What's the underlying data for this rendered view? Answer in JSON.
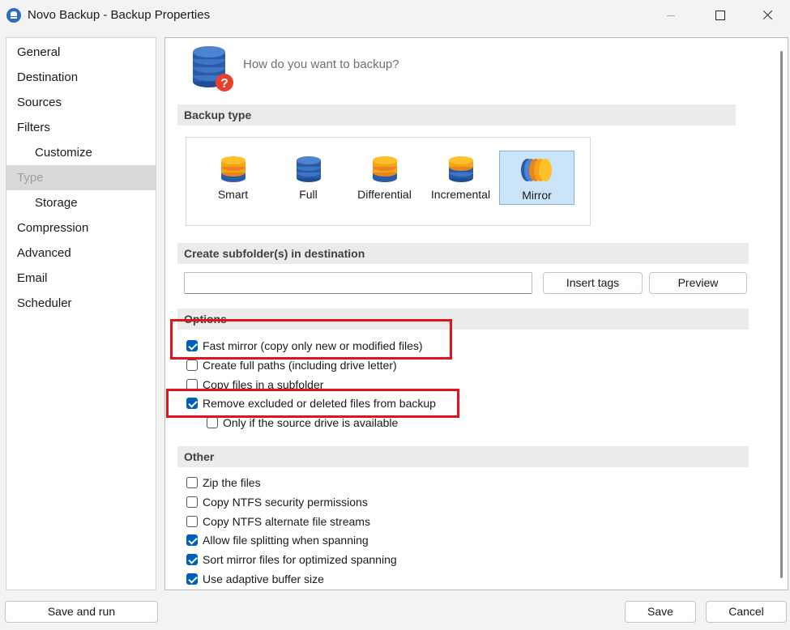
{
  "window": {
    "title": "Novo Backup - Backup Properties"
  },
  "sidebar": {
    "items": [
      {
        "label": "General",
        "level": 0,
        "selected": false
      },
      {
        "label": "Destination",
        "level": 0,
        "selected": false
      },
      {
        "label": "Sources",
        "level": 0,
        "selected": false
      },
      {
        "label": "Filters",
        "level": 0,
        "selected": false
      },
      {
        "label": "Customize",
        "level": 1,
        "selected": false
      },
      {
        "label": "Type",
        "level": 0,
        "selected": true
      },
      {
        "label": "Storage",
        "level": 1,
        "selected": false
      },
      {
        "label": "Compression",
        "level": 0,
        "selected": false
      },
      {
        "label": "Advanced",
        "level": 0,
        "selected": false
      },
      {
        "label": "Email",
        "level": 0,
        "selected": false
      },
      {
        "label": "Scheduler",
        "level": 0,
        "selected": false
      }
    ]
  },
  "header": {
    "question": "How do you want to backup?",
    "icon": "database-question-icon"
  },
  "backup_type": {
    "section_title": "Backup type",
    "selected": "Mirror",
    "types": [
      {
        "label": "Smart",
        "icon": "database-orange-icon"
      },
      {
        "label": "Full",
        "icon": "database-blue-icon"
      },
      {
        "label": "Differential",
        "icon": "database-orange-icon"
      },
      {
        "label": "Incremental",
        "icon": "database-orange-blue-icon"
      },
      {
        "label": "Mirror",
        "icon": "database-mirror-icon"
      }
    ]
  },
  "subfolder": {
    "section_title": "Create subfolder(s) in destination",
    "value": "",
    "insert_tags_label": "Insert tags",
    "preview_label": "Preview"
  },
  "options": {
    "section_title": "Options",
    "items": [
      {
        "label": "Fast mirror (copy only new or modified files)",
        "checked": true,
        "highlighted": true
      },
      {
        "label": "Create full paths (including drive letter)",
        "checked": false,
        "highlighted": false
      },
      {
        "label": "Copy files in a subfolder",
        "checked": false,
        "highlighted": false
      },
      {
        "label": "Remove excluded or deleted files from backup",
        "checked": true,
        "highlighted": true
      },
      {
        "label": "Only if the source drive is available",
        "checked": false,
        "highlighted": false
      }
    ]
  },
  "other": {
    "section_title": "Other",
    "items": [
      {
        "label": "Zip the files",
        "checked": false
      },
      {
        "label": "Copy NTFS security permissions",
        "checked": false
      },
      {
        "label": "Copy NTFS alternate file streams",
        "checked": false
      },
      {
        "label": "Allow file splitting when spanning",
        "checked": true
      },
      {
        "label": "Sort mirror files for optimized spanning",
        "checked": true
      },
      {
        "label": "Use adaptive buffer size",
        "checked": true
      }
    ]
  },
  "footer": {
    "save_and_run_label": "Save and run",
    "save_label": "Save",
    "cancel_label": "Cancel"
  },
  "colors": {
    "accent": "#005fb8",
    "highlight": "#e0141e",
    "selected_type_bg": "#cce4f7"
  }
}
